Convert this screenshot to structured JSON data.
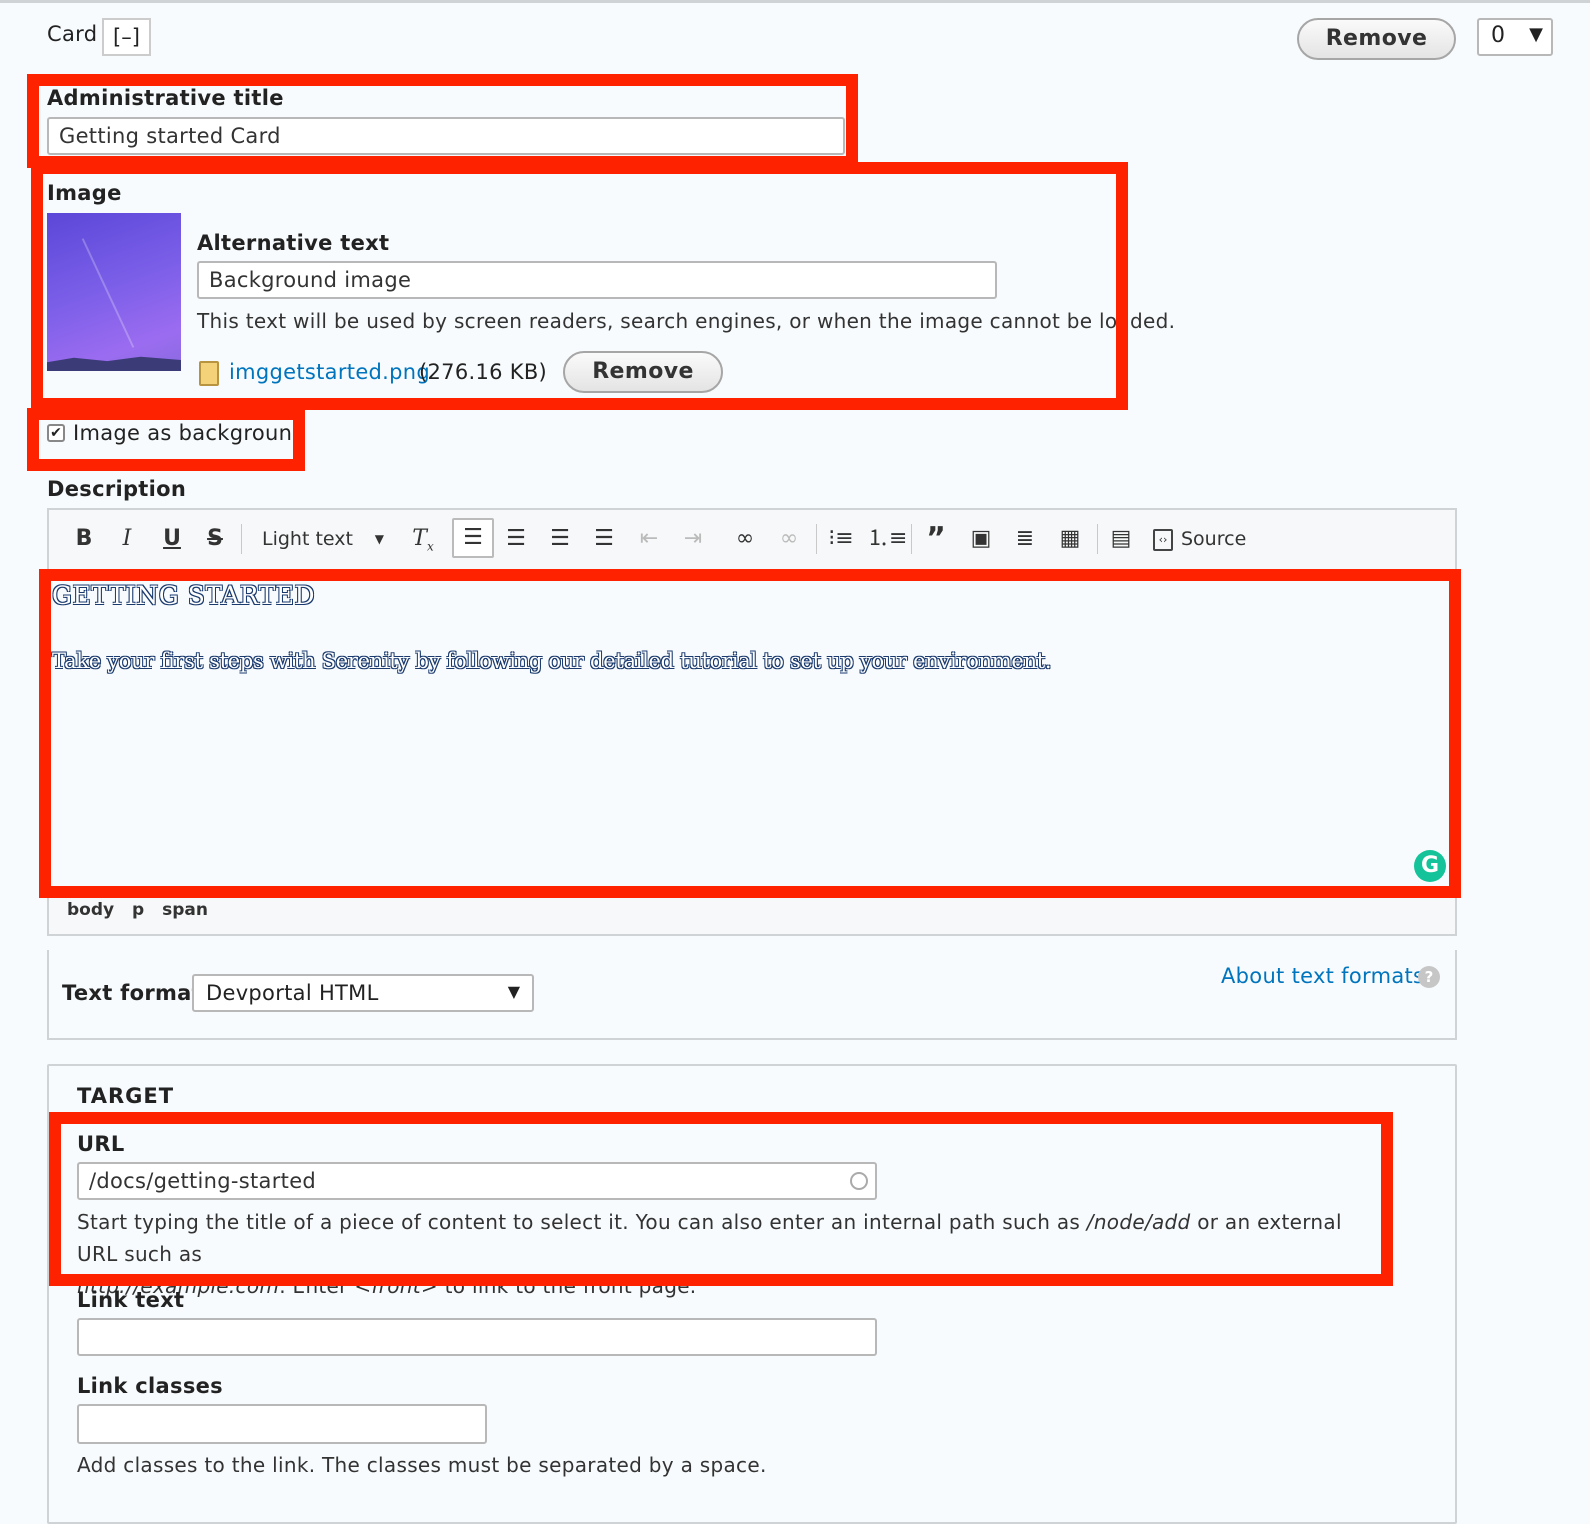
{
  "card": {
    "label": "Card",
    "collapse": "[–]",
    "remove_label": "Remove",
    "weight_value": "0"
  },
  "admin_title": {
    "label": "Administrative title",
    "value": "Getting started Card"
  },
  "image": {
    "label": "Image",
    "alt_label": "Alternative text",
    "alt_value": "Background image",
    "alt_help": "This text will be used by screen readers, search engines, or when the image cannot be loaded.",
    "file_name": "imggetstarted.png",
    "file_size": "(276.16 KB)",
    "remove_label": "Remove"
  },
  "image_as_background": {
    "label": "Image as background",
    "checked": true
  },
  "description": {
    "label": "Description",
    "toolbar": {
      "bold": "B",
      "italic": "I",
      "underline": "U",
      "strike": "S",
      "style_select": "Light text",
      "source": "Source"
    },
    "heading": "GETTING STARTED",
    "body": "Take your first steps with Serenity by following our detailed tutorial to set up your environment.",
    "path": [
      "body",
      "p",
      "span"
    ]
  },
  "text_format": {
    "label": "Text format",
    "value": "Devportal HTML",
    "about_link": "About text formats"
  },
  "target": {
    "legend": "TARGET",
    "url_label": "URL",
    "url_value": "/docs/getting-started",
    "url_help_1a": "Start typing the title of a piece of content to select it. You can also enter an internal path such as ",
    "url_help_1b": "/node/add",
    "url_help_1c": " or an external URL such as",
    "url_help_2a": "http://example.com",
    "url_help_2b": ". Enter ",
    "url_help_2c": "<front>",
    "url_help_2d": " to link to the front page.",
    "link_text_label": "Link text",
    "link_text_value": "",
    "link_classes_label": "Link classes",
    "link_classes_value": "",
    "link_classes_help": "Add classes to the link. The classes must be separated by a space."
  },
  "colors": {
    "highlight": "#ff2200",
    "link": "#0074bd",
    "page_bg": "#f7fbfd"
  }
}
